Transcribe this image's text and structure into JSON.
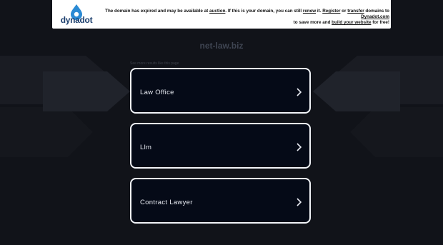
{
  "colors": {
    "background": "#111319",
    "card_background": "#050a17",
    "card_border": "#f2f4f8",
    "banner_background": "#ffffff",
    "brand": "#1c3f6e"
  },
  "banner": {
    "logo_text": "dynadot",
    "logo_icon": "dynadot-logo-icon",
    "line1_a": "The domain has expired and may be available at ",
    "auction": "auction",
    "line1_b": ". If this is your domain, you can still ",
    "renew": "renew",
    "line1_c": " it. ",
    "register": "Register",
    "line1_d": " or ",
    "transfer": "transfer",
    "line1_e": " domains to ",
    "dynadot_com": "Dynadot.com",
    "line2_a": " to save more and ",
    "build_website": "build your website",
    "line2_b": " for free!"
  },
  "domain_name": "net-law.biz",
  "related_label": "See more results like this page",
  "links": [
    {
      "label": "Law Office",
      "icon": "chevron-right-icon"
    },
    {
      "label": "Llm",
      "icon": "chevron-right-icon"
    },
    {
      "label": "Contract Lawyer",
      "icon": "chevron-right-icon"
    }
  ]
}
